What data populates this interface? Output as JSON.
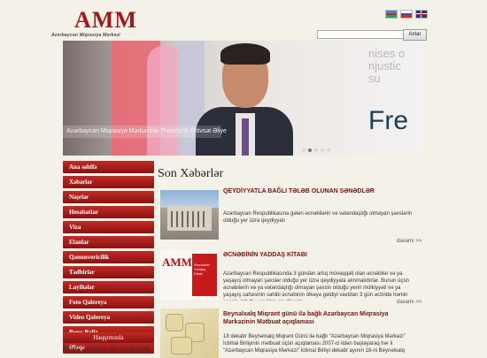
{
  "header": {
    "logo_text": "AMM",
    "logo_subtitle": "Azərbaycan Miqrasiya Mərkəzi",
    "flags": [
      "az-flag-icon",
      "ru-flag-icon",
      "uk-flag-icon"
    ],
    "search_placeholder": "",
    "search_button": "Axtar"
  },
  "banner": {
    "caption": "Azərbaycan Miqrasiya Mərkəzinin Prezidenti Əlövsət Əliye",
    "bg_text_top": "nises o\nnjustic\nsu",
    "bg_text_big": "Fre",
    "dots_count": 5,
    "active_dot": 2
  },
  "nav": {
    "items": [
      "Ana səhifə",
      "Xəbərlər",
      "Nəşrlər",
      "Hesabatlar",
      "Viza",
      "Elanlar",
      "Qanunvericilik",
      "Tədbirlər",
      "Layihələr",
      "Foto Qalereya",
      "Video Qalereya",
      "Press Reliz",
      "Əlaqə"
    ]
  },
  "sidebar": {
    "about_title": "Haqqımızda",
    "about_text": "Nazirlər tərəfindən 2007-ci ildə dövlət"
  },
  "main": {
    "section_title": "Son Xəbərlər",
    "news": [
      {
        "title": "QEYDİYYATLA BAĞLI TƏLƏB OLUNAN SƏNƏDLƏR",
        "text": "Azərbaycan Respublikasına gələn əcnəbilərin və vətəndaşlığı olmayan şəxslərin olduğu yer üzrə qeydiyyatı",
        "more": "davamı >>"
      },
      {
        "title": "ƏCNƏBİNİN YADDAŞ KİTABI",
        "text": "Azərbaycan Respublikasında 3 gündən artıq müvəqqəti olan əcnəbilər və ya yaşayış olmayan şəxslər olduğu yer üzrə qeydiyyata alınmalıdırlar. Bunun üçün əcnəbilərin və ya vətəndaşlığı olmayan şəxsin olduğu yerin mülkiyyəti və ya yaşayış sahəsinin sahibi əcnəbinin ölkəyə gəldiyi vaxtdan 3 gün ərzində həmin şəxsin olduğu yer üzrə qeydiyyata",
        "thumb_book_text": "Əcnəbinin Yaddaş Kitabı",
        "more": "davamı >>"
      },
      {
        "title": "Beynəlxalq Miqrant günü ilə bağlı Azərbaycan Miqrasiya Mərkəzinin Mətbuat açıqlaması",
        "text": "18 dekabr Beynəlxalq Miqrant Günü ilə bağlı \"Azərbaycan Miqrasiya Mərkəzi\" İctimai Birliyinin mətbuat üçün açıqlaması 2007-ci ildən başlayaraq hər il \"Azərbaycan Miqrasiya Mərkəzi\" İctimai Birliyi dekabr ayının 18-ni Beynəlxalq Miqrant Günü kimi qeyd edir. Bu il də \"Azərbaycan Miqrasiya Mərkəzi\" İctimai Birliyinin təşkilatçılığı ilə Beynəlxalq Miqrant Günü"
      }
    ]
  },
  "colors": {
    "brand_red": "#a11818",
    "nav_red": "#b2201d",
    "background": "#f4f1e8"
  }
}
